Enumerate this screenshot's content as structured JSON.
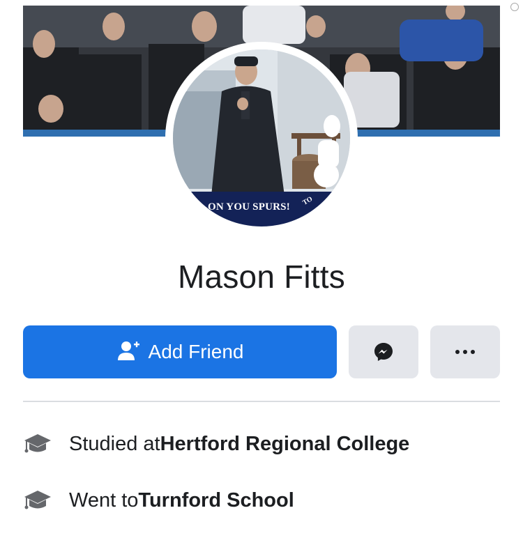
{
  "cover": {
    "image_icon": "crowd-photo"
  },
  "avatar": {
    "image_icon": "profile-photo",
    "banner_text": "ON YOU SPURS!",
    "banner_side_text": "TO"
  },
  "profile": {
    "name": "Mason Fitts"
  },
  "actions": {
    "add_friend_label": "Add Friend",
    "add_friend_icon": "add-person-icon",
    "messenger_icon": "messenger-icon",
    "more_icon": "more-dots-icon"
  },
  "intro": {
    "items": [
      {
        "prefix": "Studied at ",
        "place": "Hertford Regional College",
        "icon": "graduation-cap-icon"
      },
      {
        "prefix": "Went to ",
        "place": "Turnford School",
        "icon": "graduation-cap-icon"
      }
    ]
  },
  "colors": {
    "primary_blue": "#1b74e4",
    "button_gray": "#e4e6eb",
    "text": "#1c1e21",
    "spurs_navy": "#132257"
  }
}
